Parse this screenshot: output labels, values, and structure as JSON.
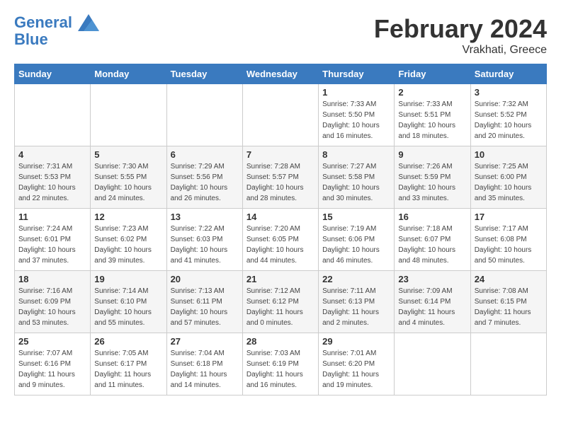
{
  "header": {
    "logo_line1": "General",
    "logo_line2": "Blue",
    "month_title": "February 2024",
    "subtitle": "Vrakhati, Greece"
  },
  "weekdays": [
    "Sunday",
    "Monday",
    "Tuesday",
    "Wednesday",
    "Thursday",
    "Friday",
    "Saturday"
  ],
  "weeks": [
    [
      {
        "day": "",
        "info": ""
      },
      {
        "day": "",
        "info": ""
      },
      {
        "day": "",
        "info": ""
      },
      {
        "day": "",
        "info": ""
      },
      {
        "day": "1",
        "info": "Sunrise: 7:33 AM\nSunset: 5:50 PM\nDaylight: 10 hours\nand 16 minutes."
      },
      {
        "day": "2",
        "info": "Sunrise: 7:33 AM\nSunset: 5:51 PM\nDaylight: 10 hours\nand 18 minutes."
      },
      {
        "day": "3",
        "info": "Sunrise: 7:32 AM\nSunset: 5:52 PM\nDaylight: 10 hours\nand 20 minutes."
      }
    ],
    [
      {
        "day": "4",
        "info": "Sunrise: 7:31 AM\nSunset: 5:53 PM\nDaylight: 10 hours\nand 22 minutes."
      },
      {
        "day": "5",
        "info": "Sunrise: 7:30 AM\nSunset: 5:55 PM\nDaylight: 10 hours\nand 24 minutes."
      },
      {
        "day": "6",
        "info": "Sunrise: 7:29 AM\nSunset: 5:56 PM\nDaylight: 10 hours\nand 26 minutes."
      },
      {
        "day": "7",
        "info": "Sunrise: 7:28 AM\nSunset: 5:57 PM\nDaylight: 10 hours\nand 28 minutes."
      },
      {
        "day": "8",
        "info": "Sunrise: 7:27 AM\nSunset: 5:58 PM\nDaylight: 10 hours\nand 30 minutes."
      },
      {
        "day": "9",
        "info": "Sunrise: 7:26 AM\nSunset: 5:59 PM\nDaylight: 10 hours\nand 33 minutes."
      },
      {
        "day": "10",
        "info": "Sunrise: 7:25 AM\nSunset: 6:00 PM\nDaylight: 10 hours\nand 35 minutes."
      }
    ],
    [
      {
        "day": "11",
        "info": "Sunrise: 7:24 AM\nSunset: 6:01 PM\nDaylight: 10 hours\nand 37 minutes."
      },
      {
        "day": "12",
        "info": "Sunrise: 7:23 AM\nSunset: 6:02 PM\nDaylight: 10 hours\nand 39 minutes."
      },
      {
        "day": "13",
        "info": "Sunrise: 7:22 AM\nSunset: 6:03 PM\nDaylight: 10 hours\nand 41 minutes."
      },
      {
        "day": "14",
        "info": "Sunrise: 7:20 AM\nSunset: 6:05 PM\nDaylight: 10 hours\nand 44 minutes."
      },
      {
        "day": "15",
        "info": "Sunrise: 7:19 AM\nSunset: 6:06 PM\nDaylight: 10 hours\nand 46 minutes."
      },
      {
        "day": "16",
        "info": "Sunrise: 7:18 AM\nSunset: 6:07 PM\nDaylight: 10 hours\nand 48 minutes."
      },
      {
        "day": "17",
        "info": "Sunrise: 7:17 AM\nSunset: 6:08 PM\nDaylight: 10 hours\nand 50 minutes."
      }
    ],
    [
      {
        "day": "18",
        "info": "Sunrise: 7:16 AM\nSunset: 6:09 PM\nDaylight: 10 hours\nand 53 minutes."
      },
      {
        "day": "19",
        "info": "Sunrise: 7:14 AM\nSunset: 6:10 PM\nDaylight: 10 hours\nand 55 minutes."
      },
      {
        "day": "20",
        "info": "Sunrise: 7:13 AM\nSunset: 6:11 PM\nDaylight: 10 hours\nand 57 minutes."
      },
      {
        "day": "21",
        "info": "Sunrise: 7:12 AM\nSunset: 6:12 PM\nDaylight: 11 hours\nand 0 minutes."
      },
      {
        "day": "22",
        "info": "Sunrise: 7:11 AM\nSunset: 6:13 PM\nDaylight: 11 hours\nand 2 minutes."
      },
      {
        "day": "23",
        "info": "Sunrise: 7:09 AM\nSunset: 6:14 PM\nDaylight: 11 hours\nand 4 minutes."
      },
      {
        "day": "24",
        "info": "Sunrise: 7:08 AM\nSunset: 6:15 PM\nDaylight: 11 hours\nand 7 minutes."
      }
    ],
    [
      {
        "day": "25",
        "info": "Sunrise: 7:07 AM\nSunset: 6:16 PM\nDaylight: 11 hours\nand 9 minutes."
      },
      {
        "day": "26",
        "info": "Sunrise: 7:05 AM\nSunset: 6:17 PM\nDaylight: 11 hours\nand 11 minutes."
      },
      {
        "day": "27",
        "info": "Sunrise: 7:04 AM\nSunset: 6:18 PM\nDaylight: 11 hours\nand 14 minutes."
      },
      {
        "day": "28",
        "info": "Sunrise: 7:03 AM\nSunset: 6:19 PM\nDaylight: 11 hours\nand 16 minutes."
      },
      {
        "day": "29",
        "info": "Sunrise: 7:01 AM\nSunset: 6:20 PM\nDaylight: 11 hours\nand 19 minutes."
      },
      {
        "day": "",
        "info": ""
      },
      {
        "day": "",
        "info": ""
      }
    ]
  ]
}
